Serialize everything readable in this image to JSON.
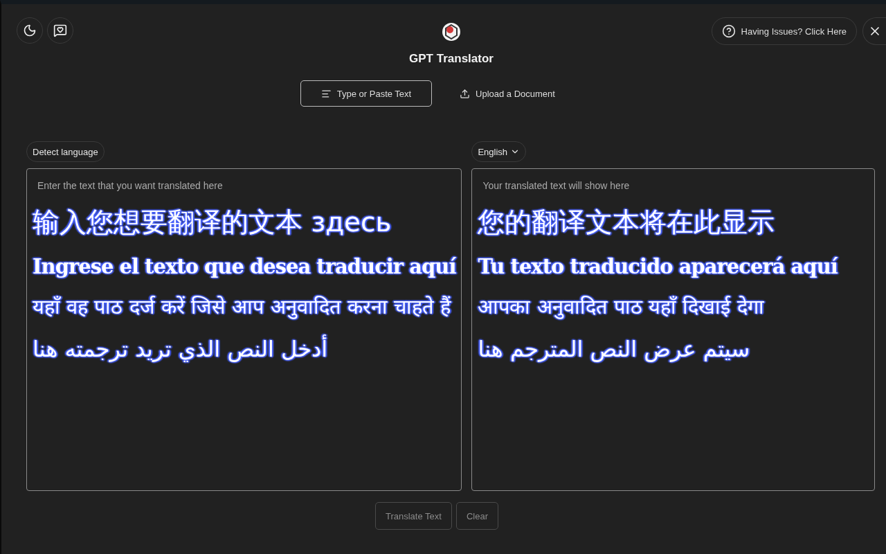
{
  "header": {
    "title": "GPT Translator",
    "help_button": "Having Issues? Click Here"
  },
  "modes": [
    {
      "label": "Type or Paste Text",
      "kind": "lines",
      "selected": true
    },
    {
      "label": "Upload a Document",
      "kind": "upload",
      "selected": false
    }
  ],
  "source": {
    "language": "Detect language",
    "placeholder": "Enter the text that you want translated here",
    "overlay": [
      {
        "text": "输入您想要翻译的文本 здесь",
        "kind": "cjk"
      },
      {
        "text": "Ingrese el texto que desea traducir aquí",
        "kind": "latin"
      },
      {
        "text": "यहाँ वह पाठ दर्ज करें जिसे आप अनुवादित करना चाहते हैं",
        "kind": "devanagari"
      },
      {
        "text": "أدخل النص الذي تريد ترجمته هنا",
        "kind": "arabic"
      }
    ]
  },
  "target": {
    "language": "English",
    "placeholder": "Your translated text will show here",
    "overlay": [
      {
        "text": "您的翻译文本将在此显示",
        "kind": "cjk"
      },
      {
        "text": "Tu texto traducido aparecerá aquí",
        "kind": "latin"
      },
      {
        "text": "आपका अनुवादित पाठ यहाँ दिखाई देगा",
        "kind": "devanagari"
      },
      {
        "text": "سيتم عرض النص المترجم هنا",
        "kind": "arabic"
      }
    ]
  },
  "actions": [
    {
      "label": "Translate Text",
      "disabled": true
    },
    {
      "label": "Clear",
      "disabled": true
    }
  ]
}
